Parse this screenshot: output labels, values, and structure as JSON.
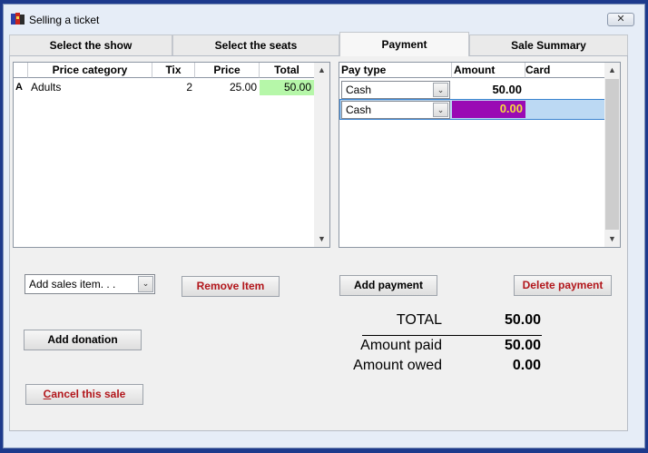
{
  "window": {
    "title": "Selling a ticket",
    "close_glyph": "✕"
  },
  "tabs": [
    {
      "label": "Select the show"
    },
    {
      "label": "Select the seats"
    },
    {
      "label": "Payment"
    },
    {
      "label": "Sale Summary"
    }
  ],
  "active_tab": "Payment",
  "price_grid": {
    "headers": {
      "category": "Price category",
      "tix": "Tix",
      "price": "Price",
      "total": "Total"
    },
    "rows": [
      {
        "marker": "A",
        "category": "Adults",
        "tix": "2",
        "price": "25.00",
        "total": "50.00"
      }
    ]
  },
  "payment_grid": {
    "headers": {
      "pay_type": "Pay type",
      "amount": "Amount",
      "card": "Card"
    },
    "rows": [
      {
        "pay_type": "Cash",
        "amount": "50.00",
        "card": ""
      },
      {
        "pay_type": "Cash",
        "amount": "0.00",
        "card": ""
      }
    ]
  },
  "sales_item_select": {
    "value": "Add sales item. . ."
  },
  "buttons": {
    "remove_item": "Remove Item",
    "add_payment": "Add payment",
    "delete_payment": "Delete payment",
    "add_donation": "Add donation",
    "cancel_sale": "Cancel this sale"
  },
  "totals": {
    "total_label": "TOTAL",
    "total_value": "50.00",
    "paid_label": "Amount paid",
    "paid_value": "50.00",
    "owed_label": "Amount owed",
    "owed_value": "0.00"
  },
  "colors": {
    "total_cell_bg": "#b6f7a9",
    "active_amount_bg": "#9a0ab4",
    "active_amount_text": "#f5dc3c",
    "active_row_bg": "#bcd9f3",
    "cancel_accent": "#b2161b"
  },
  "icons": {
    "app": "ticket-app-icon",
    "dropdown": "chevron-down-icon",
    "scroll_up": "scroll-up-icon",
    "scroll_down": "scroll-down-icon"
  }
}
